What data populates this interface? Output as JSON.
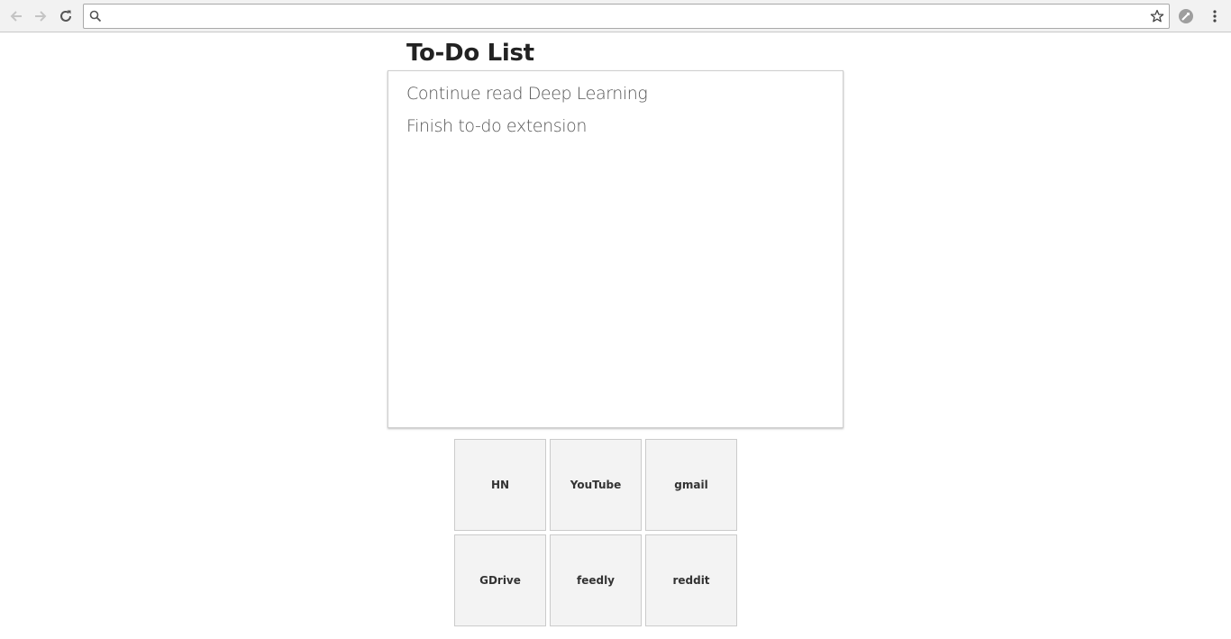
{
  "browser": {
    "address_value": "",
    "icons": {
      "back": "arrow-left-icon",
      "forward": "arrow-right-icon",
      "reload": "reload-icon",
      "search": "search-icon",
      "bookmark": "star-icon",
      "extension": "extension-icon",
      "menu": "kebab-menu-icon"
    }
  },
  "page": {
    "title": "To-Do List",
    "todos": [
      "Continue read Deep Learning",
      "Finish to-do extension"
    ],
    "shortcuts": [
      {
        "label": "HN"
      },
      {
        "label": "YouTube"
      },
      {
        "label": "gmail"
      },
      {
        "label": "GDrive"
      },
      {
        "label": "feedly"
      },
      {
        "label": "reddit"
      }
    ]
  },
  "colors": {
    "toolbar_bg": "#f2f2f2",
    "tile_bg": "#f3f3f3",
    "title_text": "#222222",
    "todo_text": "#555555"
  }
}
